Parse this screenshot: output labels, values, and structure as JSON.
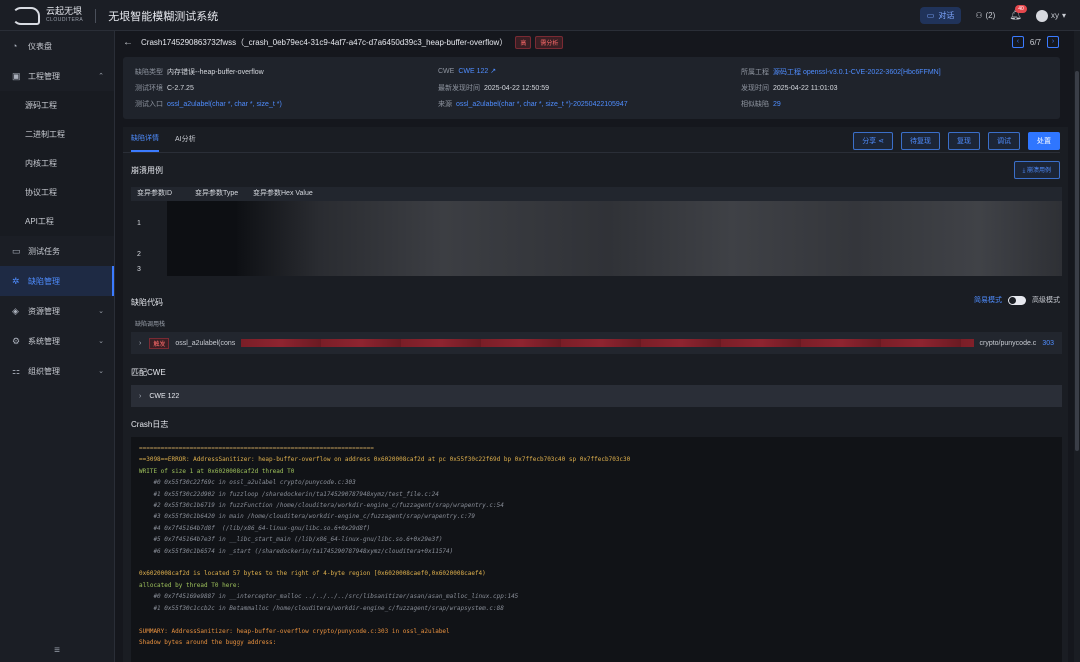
{
  "topbar": {
    "logo_cn": "云起无垠",
    "logo_en": "CLOUDITERA",
    "system_title": "无垠智能模糊测试系统",
    "chat_label": "对话",
    "team_label": "(2)",
    "bell_badge": "40",
    "user_name": "xy"
  },
  "sidebar": {
    "items": [
      {
        "label": "仪表盘",
        "icon": "dashboard-icon"
      },
      {
        "label": "工程管理",
        "icon": "project-icon"
      },
      {
        "label": "测试任务",
        "icon": "task-icon"
      },
      {
        "label": "缺陷管理",
        "icon": "bug-icon"
      },
      {
        "label": "资源管理",
        "icon": "resource-icon"
      },
      {
        "label": "系统管理",
        "icon": "settings-icon"
      },
      {
        "label": "组织管理",
        "icon": "org-icon"
      }
    ],
    "subitems": [
      "源码工程",
      "二进制工程",
      "内核工程",
      "协议工程",
      "API工程"
    ],
    "bottom": "≡"
  },
  "header": {
    "title": "Crash1745290863732fwss（_crash_0eb79ec4-31c9-4af7-a47c-d7a6450d39c3_heap-buffer-overflow）",
    "severity": "高",
    "status": "需分析",
    "page": "6/7"
  },
  "info": {
    "col1": [
      {
        "label": "缺陷类型",
        "value": "内存错误--heap-buffer-overflow"
      },
      {
        "label": "测试环境",
        "value": "C-2.7.25"
      },
      {
        "label": "测试入口",
        "value": "ossl_a2ulabel(char *, char *, size_t *)"
      }
    ],
    "col2": [
      {
        "label": "CWE",
        "value": "CWE 122"
      },
      {
        "label": "最新发现时间",
        "value": "2025-04-22 12:50:59"
      },
      {
        "label": "来源",
        "value": "ossl_a2ulabel(char *, char *, size_t *)-20250422105947"
      }
    ],
    "col3": [
      {
        "label": "所属工程",
        "value": "源码工程  openssl-v3.0.1-CVE-2022-3602[Hbc6FFMN]"
      },
      {
        "label": "发现时间",
        "value": "2025-04-22 11:01:03"
      },
      {
        "label": "相似缺陷",
        "value": "29"
      }
    ]
  },
  "tabs": [
    "缺陷详情",
    "AI分析"
  ],
  "actions": [
    "分享",
    "待复现",
    "复现",
    "调试",
    "处置"
  ],
  "crash_case": {
    "title": "崩溃用例",
    "button": "崩溃用例",
    "headers": [
      "变异参数ID",
      "变异参数Type",
      "变异参数Hex Value"
    ],
    "rows": [
      "1",
      "2",
      "3"
    ]
  },
  "defect_code": {
    "title": "缺陷代码",
    "simple_mode": "简易模式",
    "advanced_mode": "高级模式",
    "stack_label": "缺陷调用栈",
    "trigger": "触发",
    "func": "ossl_a2ulabel(cons",
    "file": "crypto/punycode.c",
    "line": "303"
  },
  "cwe": {
    "title": "匹配CWE",
    "item": "CWE 122"
  },
  "log": {
    "title": "Crash日志",
    "lines": [
      {
        "cls": "c-sep",
        "text": "================================================================="
      },
      {
        "cls": "c-err",
        "text": "==3098==ERROR: AddressSanitizer: heap-buffer-overflow on address 0x6020008caf2d at pc 0x55f30c22f69d bp 0x7ffecb703c40 sp 0x7ffecb703c30"
      },
      {
        "cls": "c-grn",
        "text": "WRITE of size 1 at 0x6020008caf2d thread T0"
      },
      {
        "cls": "c-frame",
        "text": "    #0 0x55f30c22f69c in ossl_a2ulabel crypto/punycode.c:303"
      },
      {
        "cls": "c-frame",
        "text": "    #1 0x55f30c22d902 in fuzzloop /sharedockerin/ta1745290787948xymz/test_file.c:24"
      },
      {
        "cls": "c-frame",
        "text": "    #2 0x55f30c1b6719 in fuzzFunction /home/clouditera/workdir-engine_c/fuzzagent/srap/wrapentry.c:54"
      },
      {
        "cls": "c-frame",
        "text": "    #3 0x55f30c1b6420 in main /home/clouditera/workdir-engine_c/fuzzagent/srap/wrapentry.c:79"
      },
      {
        "cls": "c-frame",
        "text": "    #4 0x7f45164b7d8f  (/lib/x86_64-linux-gnu/libc.so.6+0x29d8f)"
      },
      {
        "cls": "c-frame",
        "text": "    #5 0x7f45164b7e3f in __libc_start_main (/lib/x86_64-linux-gnu/libc.so.6+0x29e3f)"
      },
      {
        "cls": "c-frame",
        "text": "    #6 0x55f30c1b6574 in _start (/sharedockerin/ta1745290787948xymz/clouditera+0x11574)"
      },
      {
        "cls": "c-frame",
        "text": " "
      },
      {
        "cls": "c-err",
        "text": "0x6020008caf2d is located 57 bytes to the right of 4-byte region [0x6020008caef0,0x6020008caef4)"
      },
      {
        "cls": "c-grn",
        "text": "allocated by thread T0 here:"
      },
      {
        "cls": "c-frame",
        "text": "    #0 0x7f45169e9887 in __interceptor_malloc ../../../../src/libsanitizer/asan/asan_malloc_linux.cpp:145"
      },
      {
        "cls": "c-frame",
        "text": "    #1 0x55f30c1ccb2c in Betammalloc /home/clouditera/workdir-engine_c/fuzzagent/srap/wrapsystem.c:88"
      },
      {
        "cls": "c-frame",
        "text": " "
      },
      {
        "cls": "c-ora",
        "text": "SUMMARY: AddressSanitizer: heap-buffer-overflow crypto/punycode.c:303 in ossl_a2ulabel"
      },
      {
        "cls": "c-ora",
        "text": "Shadow bytes around the buggy address:"
      }
    ]
  },
  "colors": {
    "accent": "#2f76ff",
    "danger": "#ff6b6b",
    "bg": "#15171d"
  }
}
